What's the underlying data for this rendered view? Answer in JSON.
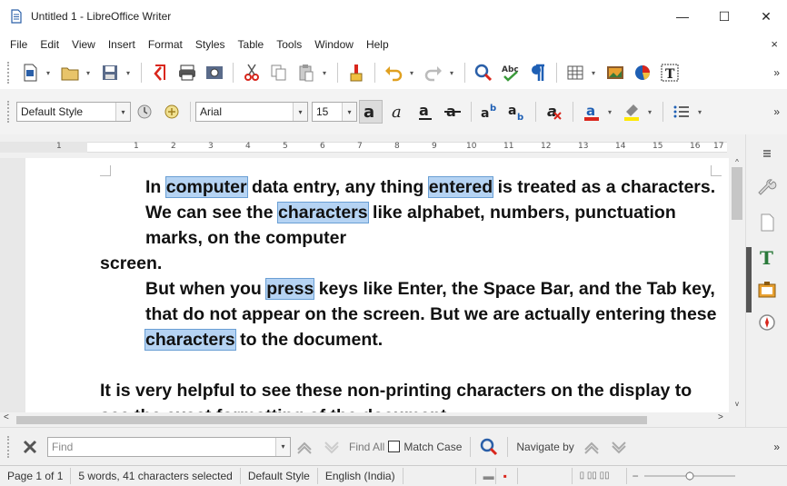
{
  "window": {
    "title": "Untitled 1 - LibreOffice Writer",
    "minimize_label": "—",
    "maximize_label": "☐",
    "close_label": "✕"
  },
  "menubar": {
    "items": [
      "File",
      "Edit",
      "View",
      "Insert",
      "Format",
      "Styles",
      "Table",
      "Tools",
      "Window",
      "Help"
    ],
    "close_doc_label": "×"
  },
  "toolbar_standard": {
    "icons": [
      "new-document-icon",
      "open-icon",
      "save-icon",
      "export-pdf-icon",
      "print-icon",
      "print-preview-icon",
      "cut-icon",
      "copy-icon",
      "paste-icon",
      "clone-formatting-icon",
      "undo-icon",
      "redo-icon",
      "find-replace-icon",
      "spelling-icon",
      "formatting-marks-icon",
      "insert-table-icon",
      "insert-image-icon",
      "insert-chart-icon",
      "insert-textbox-icon"
    ],
    "overflow_label": "»"
  },
  "toolbar_formatting": {
    "paragraph_style": "Default Style",
    "font_name": "Arial",
    "font_size": "15",
    "overflow_label": "»"
  },
  "ruler": {
    "numbers": [
      "1",
      "1",
      "2",
      "3",
      "4",
      "5",
      "6",
      "7",
      "8",
      "9",
      "10",
      "11",
      "12",
      "13",
      "14",
      "15",
      "16",
      "17"
    ]
  },
  "document": {
    "paragraphs": [
      {
        "indent": true,
        "segments": [
          {
            "text": "In ",
            "sel": false
          },
          {
            "text": "computer",
            "sel": true
          },
          {
            "text": " data entry, any thing ",
            "sel": false
          },
          {
            "text": "entered",
            "sel": true
          },
          {
            "text": " is treated as a characters. We can see the ",
            "sel": false
          },
          {
            "text": "characters",
            "sel": true
          },
          {
            "text": " like alphabet, numbers, punctuation marks, on the computer",
            "sel": false
          }
        ]
      },
      {
        "indent": false,
        "segments": [
          {
            "text": "screen.",
            "sel": false
          }
        ]
      },
      {
        "indent": true,
        "segments": [
          {
            "text": "But when you ",
            "sel": false
          },
          {
            "text": "press",
            "sel": true
          },
          {
            "text": " keys like Enter, the Space Bar, and the Tab key, that do not appear on the screen. But we are actually entering these ",
            "sel": false
          },
          {
            "text": "characters",
            "sel": true
          },
          {
            "text": " to the document.",
            "sel": false
          }
        ]
      },
      {
        "indent": false,
        "blank": true,
        "segments": []
      },
      {
        "indent": false,
        "segments": [
          {
            "text": "It is very helpful to see these non-printing characters on the display to see the exact formatting of the document",
            "sel": false
          }
        ]
      }
    ]
  },
  "scrollbars": {
    "up": "^",
    "down": "v",
    "left": "<",
    "right": ">"
  },
  "findbar": {
    "placeholder": "Find",
    "find_all": "Find All",
    "match_case": "Match Case",
    "navigate_by": "Navigate by",
    "overflow_label": "»"
  },
  "statusbar": {
    "page": "Page 1 of 1",
    "selection": "5 words, 41 characters selected",
    "style": "Default Style",
    "language": "English (India)"
  },
  "colors": {
    "selection_fill": "#b5d3f3",
    "selection_border": "#6a9fd4",
    "accent_red": "#d9261c",
    "accent_blue": "#1e5fb4"
  }
}
